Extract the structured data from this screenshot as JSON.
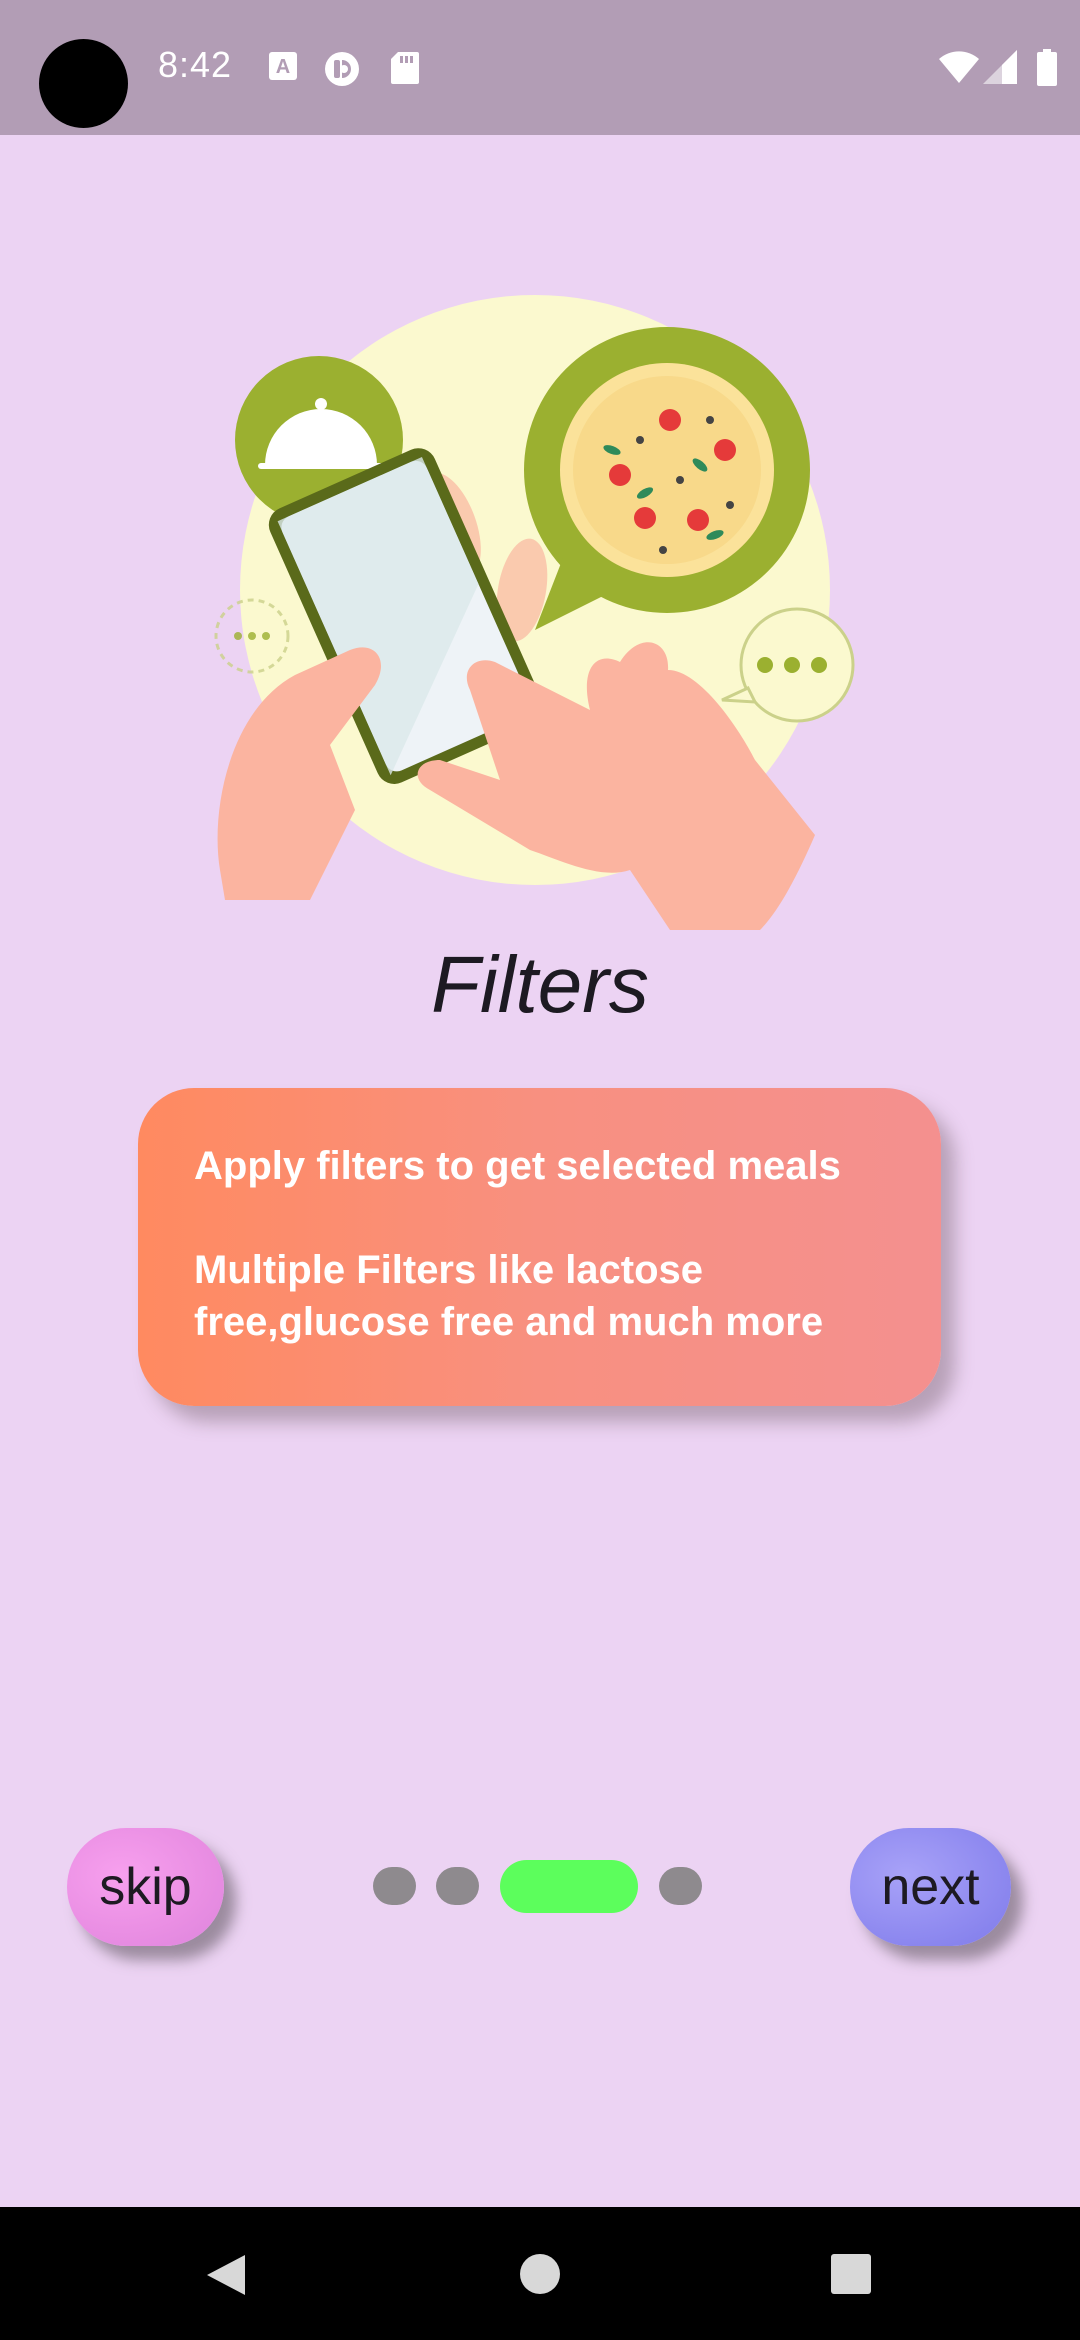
{
  "status_bar": {
    "time": "8:42",
    "left_icons": [
      "camera-cutout",
      "font-a-icon",
      "sync-circle-icon",
      "sd-card-icon"
    ],
    "right_icons": [
      "wifi-icon",
      "cell-signal-icon",
      "battery-icon"
    ],
    "background": "#b29db5"
  },
  "onboarding": {
    "illustration": "hands-phone-food-order-illustration",
    "title": "Filters",
    "description": {
      "line1": "Apply filters to get selected meals",
      "line2": "Multiple Filters like lactose free,glucose free and much more"
    },
    "skip_label": "skip",
    "next_label": "next",
    "page_indicator": {
      "total": 4,
      "active": 3
    }
  },
  "nav_bar": {
    "icons": [
      "back-triangle-icon",
      "home-circle-icon",
      "recents-square-icon"
    ]
  },
  "colors": {
    "background": "#ecd3f3",
    "card_gradient_start": "#ff8a60",
    "card_gradient_end": "#f4908f",
    "active_dot": "#5cfe5c",
    "inactive_dot": "#8e8a8e",
    "skip_button": "#e98ee3",
    "next_button": "#8f8af0"
  }
}
